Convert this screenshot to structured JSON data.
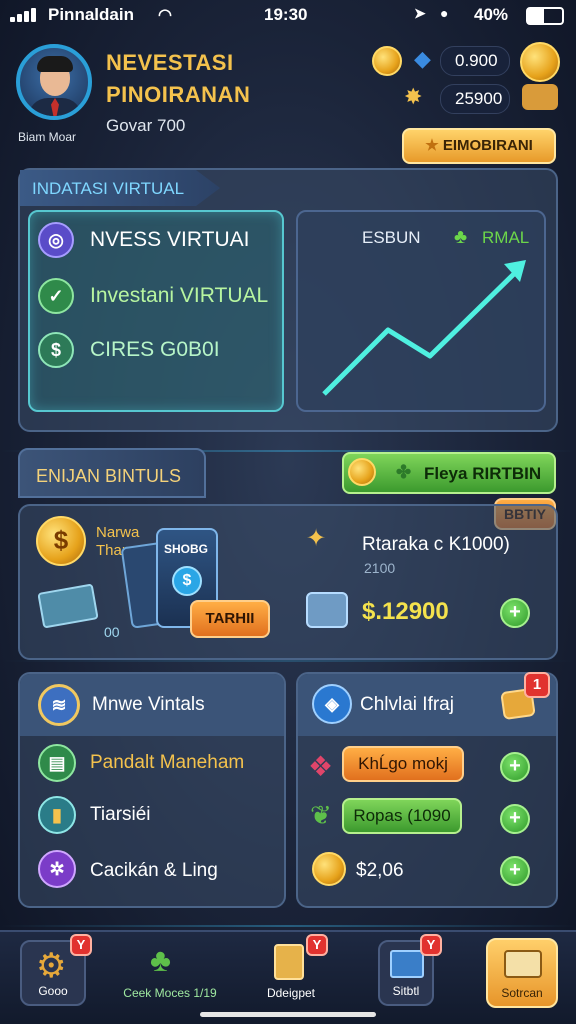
{
  "status_bar": {
    "carrier": "Pinnaldain",
    "time": "19:30",
    "battery": "40%"
  },
  "header": {
    "title_line1": "NEVESTASI",
    "title_line2": "PINOIRANAN",
    "subtitle": "Govar 700",
    "player_name": "Biam Moar",
    "balance_1": "0.900",
    "balance_2": "25900",
    "top_button": "EIMOBIRANI"
  },
  "virtual_panel": {
    "tab_label": "INDATASI VIRTUAL",
    "options": [
      {
        "label": "NVESS VIRTUAI",
        "icon": "target-icon"
      },
      {
        "label": "Investani VIRTUAL",
        "icon": "check-icon"
      },
      {
        "label": "CIRES G0B0I",
        "icon": "coins-icon"
      }
    ],
    "chart_left_label": "ESBUN",
    "chart_right_label": "RMAL"
  },
  "bonus_section": {
    "tab_label": "ENIJAN BINTULS",
    "play_button": "Fleya RIRTBIN",
    "corner_tag": "BBTIY",
    "card_text_1": "Narwa",
    "card_text_2": "Thansa",
    "card_box_label": "SHOBG",
    "card_small": "00",
    "card_button": "TARHII",
    "reward_title": "Rtaraka c K1000)",
    "reward_sub": "2100",
    "reward_value": "$.12900"
  },
  "left_panel": {
    "title": "Mnwe Vintals",
    "items": [
      {
        "label": "Pandalt Maneham",
        "icon": "document-icon"
      },
      {
        "label": "Tiarsiéi",
        "icon": "bottle-icon"
      },
      {
        "label": "Cacikán & Ling",
        "icon": "gear-icon"
      }
    ]
  },
  "right_panel": {
    "title": "Chlvlai Ifraj",
    "badge": "1",
    "items": [
      {
        "label": "KhĹgo mokj"
      },
      {
        "label": "Ropas (1090"
      },
      {
        "label": "$2,06"
      }
    ]
  },
  "bottom_nav": [
    {
      "label": "Gooo",
      "badge": "Y"
    },
    {
      "label": "Ceek Moces 1/19"
    },
    {
      "label": "Ddeigpet",
      "badge": "Y"
    },
    {
      "label": "Sitbtl",
      "badge": "Y"
    },
    {
      "label": "Sotrcan"
    }
  ],
  "colors": {
    "gold": "#f4c24d",
    "teal": "#57c7d0",
    "green": "#5ec04a",
    "panel": "#3a4c68"
  }
}
